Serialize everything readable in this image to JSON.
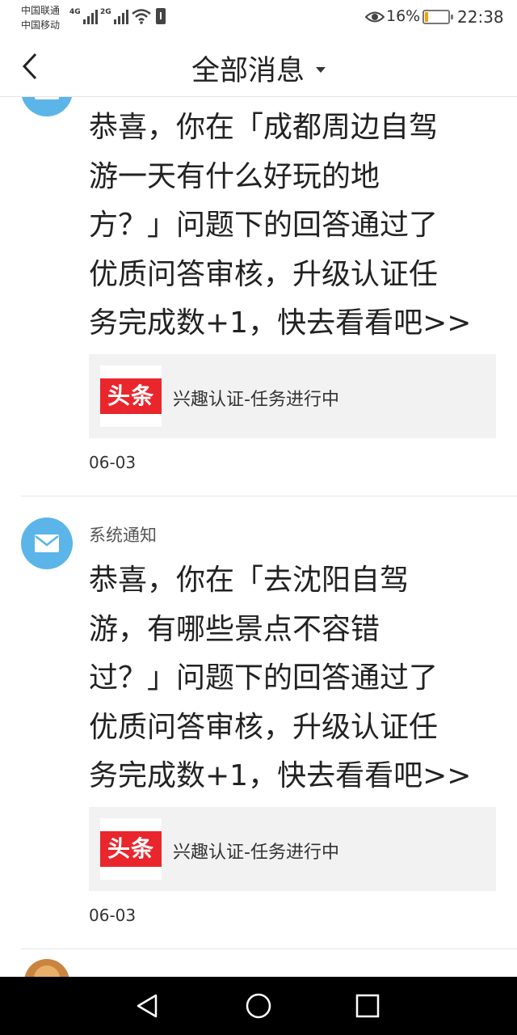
{
  "status_bar": {
    "carrier1": "中国联通",
    "carrier2": "中国移动",
    "net1": "4G",
    "net2": "2G",
    "battery_pct": "16%",
    "battery_level": 0.16,
    "time": "22:38"
  },
  "header": {
    "title": "全部消息",
    "back_icon": "chevron-left-icon",
    "dropdown_icon": "caret-down-icon"
  },
  "messages": [
    {
      "sender": "",
      "body_lines": [
        "恭喜，你在「成都周边自驾",
        "游一天有什么好玩的地",
        "方？」问题下的回答通过了",
        "优质问答审核，升级认证任",
        "务完成数+1，快去看看吧>>"
      ],
      "card": {
        "logo_text": "头条",
        "label": "兴趣认证-任务进行中"
      },
      "date": "06-03"
    },
    {
      "sender": "系统通知",
      "body_lines": [
        "恭喜，你在「去沈阳自驾",
        "游，有哪些景点不容错",
        "过？」问题下的回答通过了",
        "优质问答审核，升级认证任",
        "务完成数+1，快去看看吧>>"
      ],
      "card": {
        "logo_text": "头条",
        "label": "兴趣认证-任务进行中"
      },
      "date": "06-03"
    }
  ],
  "colors": {
    "avatar": "#5bb5e8",
    "logo_red": "#e9262c",
    "battery": "#f2a300"
  },
  "nav_bar": {
    "back_icon": "triangle-back-icon",
    "home_icon": "circle-home-icon",
    "recents_icon": "square-recents-icon"
  }
}
